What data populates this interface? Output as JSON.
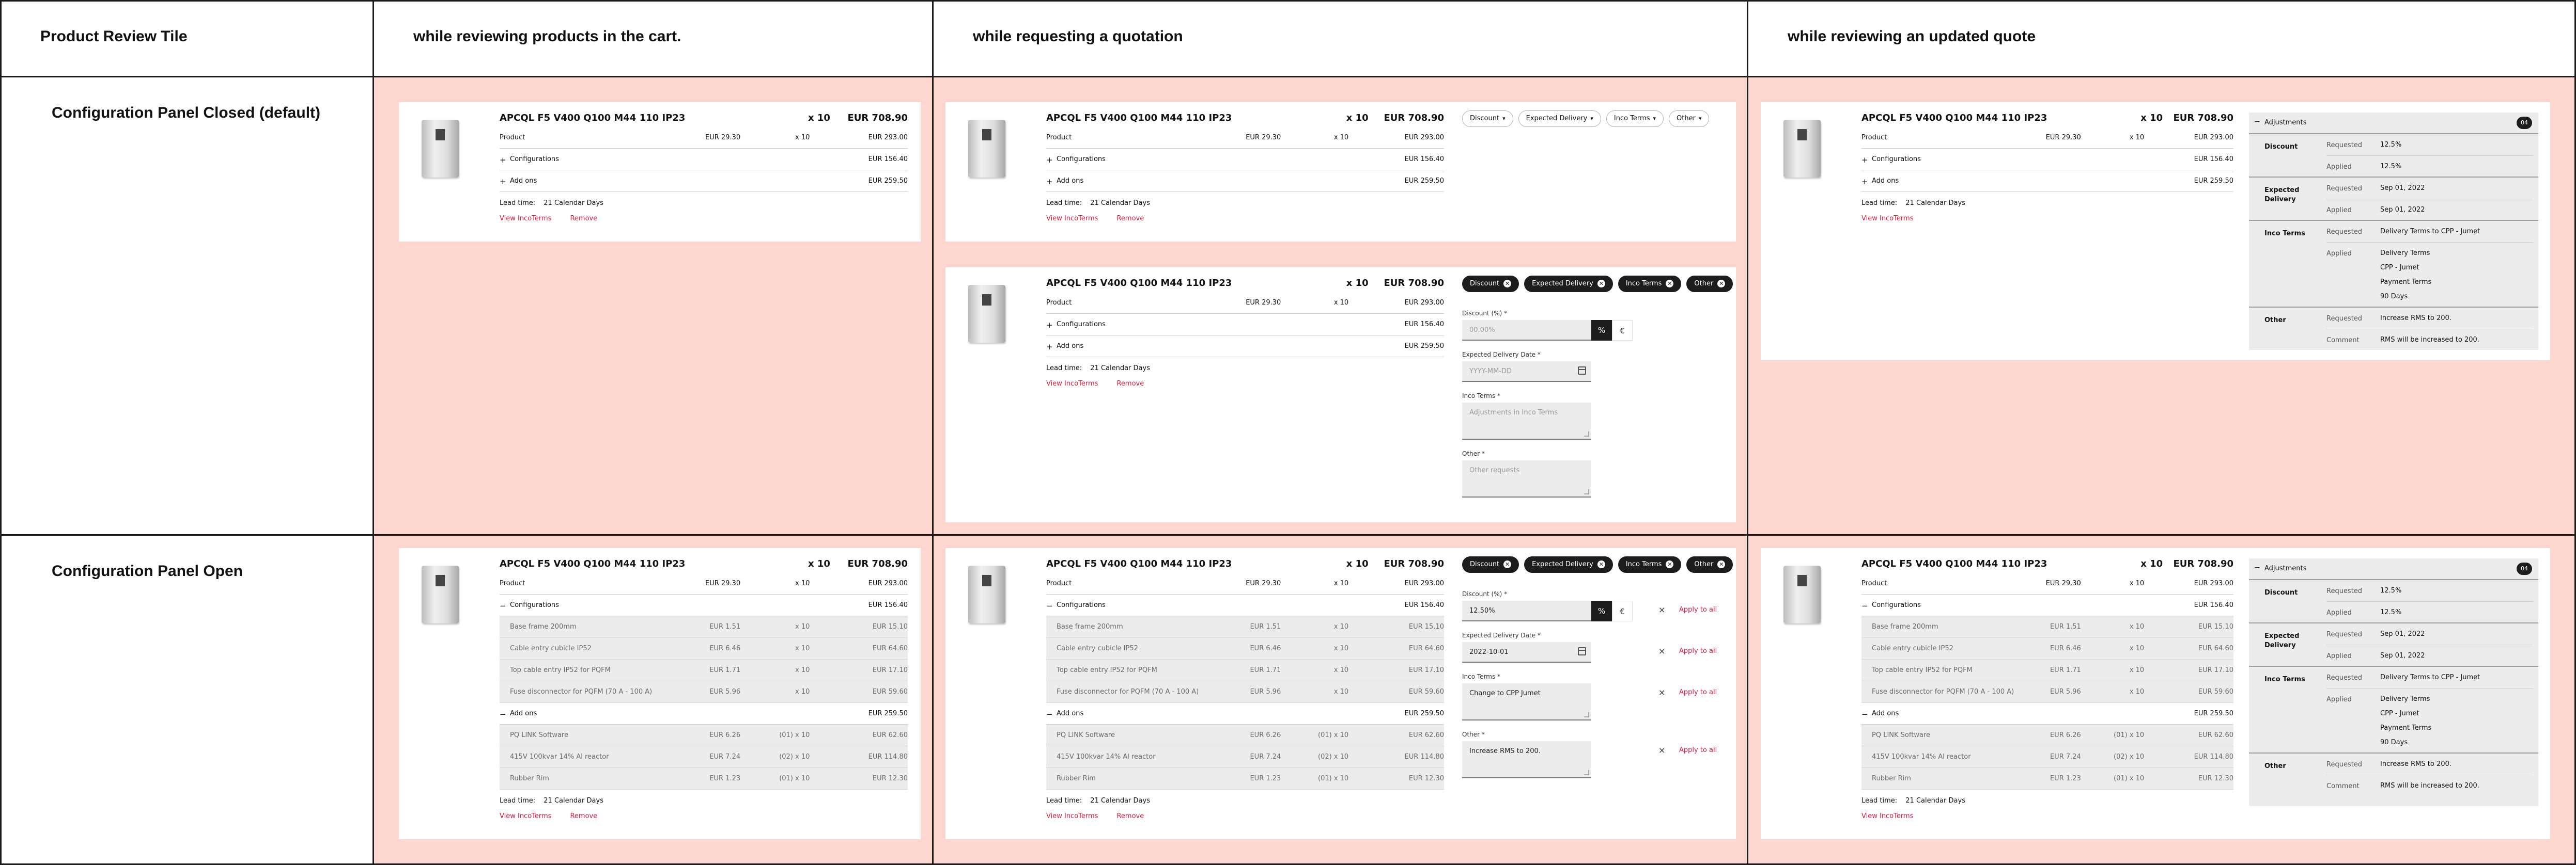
{
  "headers": {
    "c0": "Product Review Tile",
    "c1": "while reviewing products in the cart.",
    "c2": "while requesting a quotation",
    "c3": "while reviewing an updated quote",
    "r1": "Configuration Panel Closed (default)",
    "r2": "Configuration Panel Open"
  },
  "product": {
    "title": "APCQL F5 V400 Q100 M44 110 IP23",
    "qty": "x 10",
    "total": "EUR 708.90",
    "row_product": {
      "label": "Product",
      "unit": "EUR 29.30",
      "qty": "x 10",
      "total": "EUR 293.00"
    },
    "row_config": {
      "label": "Configurations",
      "total": "EUR 156.40"
    },
    "row_addons": {
      "label": "Add ons",
      "total": "EUR 259.50"
    },
    "config_items": [
      {
        "label": "Base frame 200mm",
        "unit": "EUR 1.51",
        "qty": "x 10",
        "total": "EUR 15.10"
      },
      {
        "label": "Cable entry cubicle IP52",
        "unit": "EUR 6.46",
        "qty": "x 10",
        "total": "EUR 64.60"
      },
      {
        "label": "Top cable entry IP52 for PQFM",
        "unit": "EUR 1.71",
        "qty": "x 10",
        "total": "EUR 17.10"
      },
      {
        "label": "Fuse disconnector for PQFM (70 A - 100 A)",
        "unit": "EUR 5.96",
        "qty": "x 10",
        "total": "EUR 59.60"
      }
    ],
    "addon_items": [
      {
        "label": "PQ LINK Software",
        "unit": "EUR 6.26",
        "qty": "(01) x 10",
        "total": "EUR 62.60"
      },
      {
        "label": "415V 100kvar 14% Al reactor",
        "unit": "EUR 7.24",
        "qty": "(02) x 10",
        "total": "EUR 114.80"
      },
      {
        "label": "Rubber Rim",
        "unit": "EUR 1.23",
        "qty": "(01) x 10",
        "total": "EUR 12.30"
      }
    ],
    "lead_label": "Lead time:",
    "lead_value": "21 Calendar Days",
    "link_incoterms": "View IncoTerms",
    "link_remove": "Remove",
    "plus": "+",
    "minus": "−"
  },
  "chips": {
    "discount": "Discount",
    "delivery": "Expected Delivery",
    "inco": "Inco Terms",
    "other": "Other"
  },
  "form": {
    "discount_label": "Discount (%) *",
    "discount_placeholder": "00.00%",
    "discount_value": "12.50%",
    "unit_pct": "%",
    "unit_eur": "€",
    "delivery_label": "Expected Delivery Date *",
    "delivery_placeholder": "YYYY-MM-DD",
    "delivery_value": "2022-10-01",
    "inco_label": "Inco Terms *",
    "inco_placeholder": "Adjustments in Inco Terms",
    "inco_value": "Change to CPP Jumet",
    "other_label": "Other *",
    "other_placeholder": "Other requests",
    "other_value": "Increase RMS to 200.",
    "apply_all": "Apply to all",
    "clear": "×"
  },
  "adjustments": {
    "title": "Adjustments",
    "count": "04",
    "discount": {
      "label": "Discount",
      "requested_k": "Requested",
      "requested_v": "12.5%",
      "applied_k": "Applied",
      "applied_v": "12.5%"
    },
    "delivery": {
      "label": "Expected Delivery",
      "requested_k": "Requested",
      "requested_v": "Sep 01, 2022",
      "applied_k": "Applied",
      "applied_v": "Sep 01, 2022"
    },
    "inco": {
      "label": "Inco Terms",
      "requested_k": "Requested",
      "requested_v": "Delivery Terms to CPP - Jumet",
      "applied_k": "Applied",
      "applied_v": [
        "Delivery Terms",
        "CPP - Jumet",
        "Payment Terms",
        "90 Days"
      ]
    },
    "other": {
      "label": "Other",
      "requested_k": "Requested",
      "requested_v": "Increase RMS to 200.",
      "comment_k": "Comment",
      "comment_v": "RMS will be increased to 200."
    }
  }
}
